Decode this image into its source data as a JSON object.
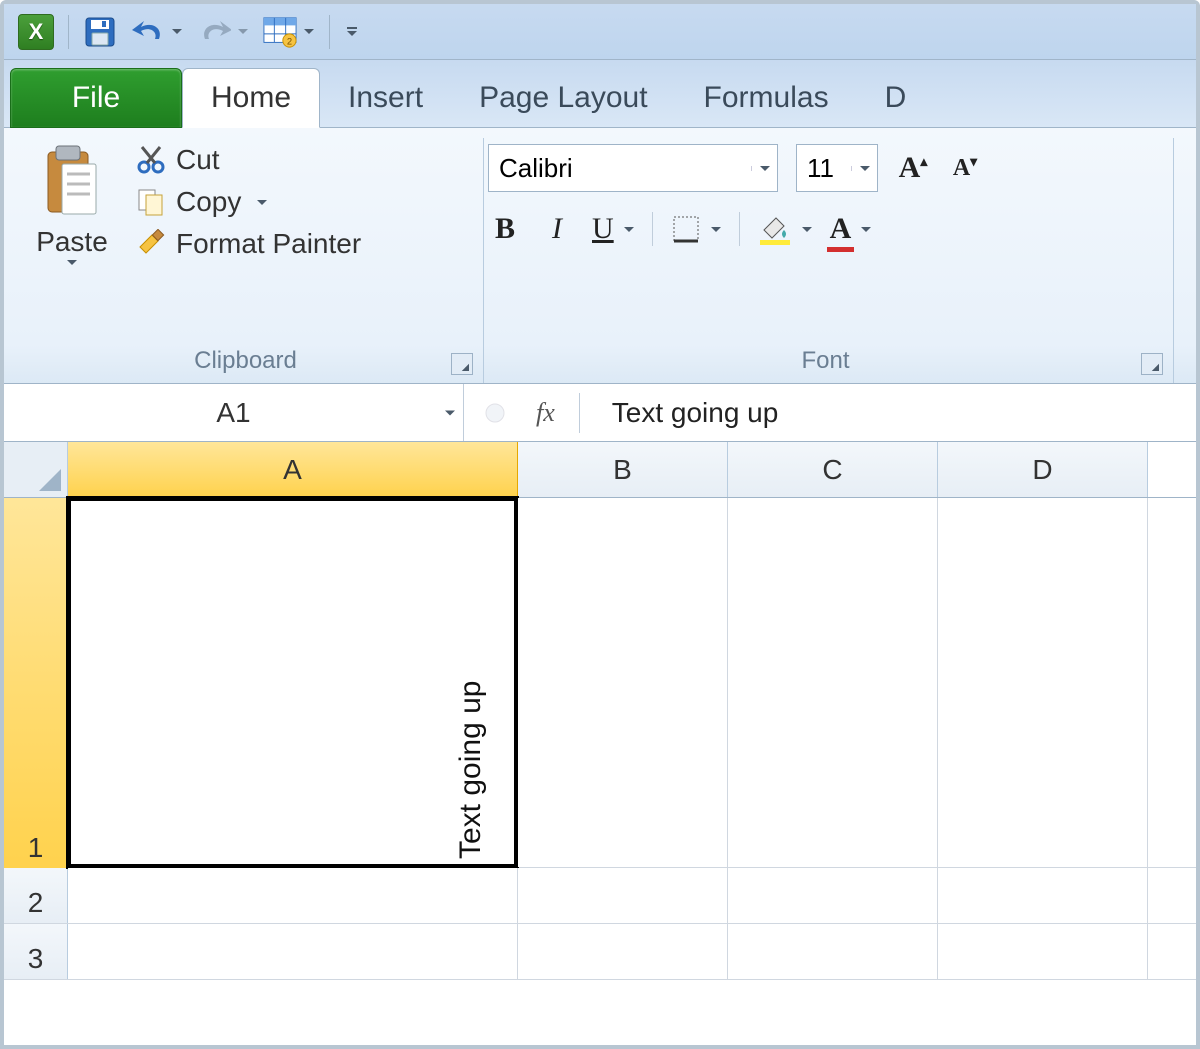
{
  "qat": {
    "excel_logo_letter": "X",
    "save_label": "Save",
    "undo_label": "Undo",
    "redo_label": "Redo",
    "table_label": "Table"
  },
  "tabs": {
    "file": "File",
    "home": "Home",
    "insert": "Insert",
    "page_layout": "Page Layout",
    "formulas": "Formulas",
    "partial_d": "D"
  },
  "ribbon": {
    "clipboard": {
      "paste": "Paste",
      "cut": "Cut",
      "copy": "Copy",
      "format_painter": "Format Painter",
      "group_title": "Clipboard"
    },
    "font": {
      "font_name": "Calibri",
      "font_size": "11",
      "bold": "B",
      "italic": "I",
      "underline": "U",
      "group_title": "Font"
    }
  },
  "formula_bar": {
    "name_box": "A1",
    "fx": "fx",
    "content": "Text going up"
  },
  "grid": {
    "columns": [
      "A",
      "B",
      "C",
      "D"
    ],
    "rows": [
      "1",
      "2",
      "3"
    ],
    "cells": {
      "A1": "Text going up"
    },
    "selected": "A1"
  }
}
